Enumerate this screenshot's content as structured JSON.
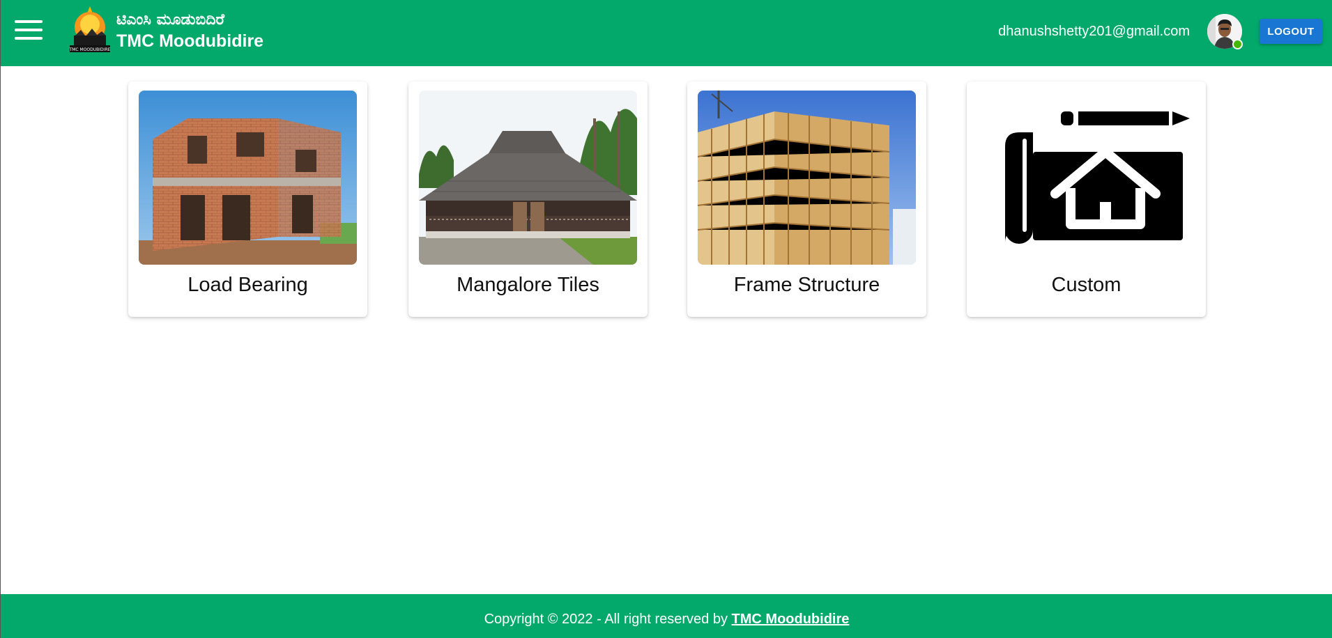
{
  "header": {
    "brand_kannada": "ಟಿಎಂಸಿ ಮೂಡುಬಿದಿರೆ",
    "brand_english": "TMC Moodubidire",
    "logo_text": "TMC MOODUBIDIRE",
    "user_email": "dhanushshetty201@gmail.com",
    "logout_label": "LOGOUT"
  },
  "cards": [
    {
      "label": "Load Bearing",
      "image": "brick-house-photo"
    },
    {
      "label": "Mangalore Tiles",
      "image": "tiled-roof-house-photo"
    },
    {
      "label": "Frame Structure",
      "image": "wood-frame-building-photo"
    },
    {
      "label": "Custom",
      "image": "blueprint-house-icon"
    }
  ],
  "footer": {
    "copyright_text": "Copyright © 2022 - All right reserved by",
    "link_label": "TMC Moodubidire"
  },
  "colors": {
    "brand_green": "#03a96b",
    "logout_blue": "#1976d2",
    "online_green": "#44b700"
  }
}
